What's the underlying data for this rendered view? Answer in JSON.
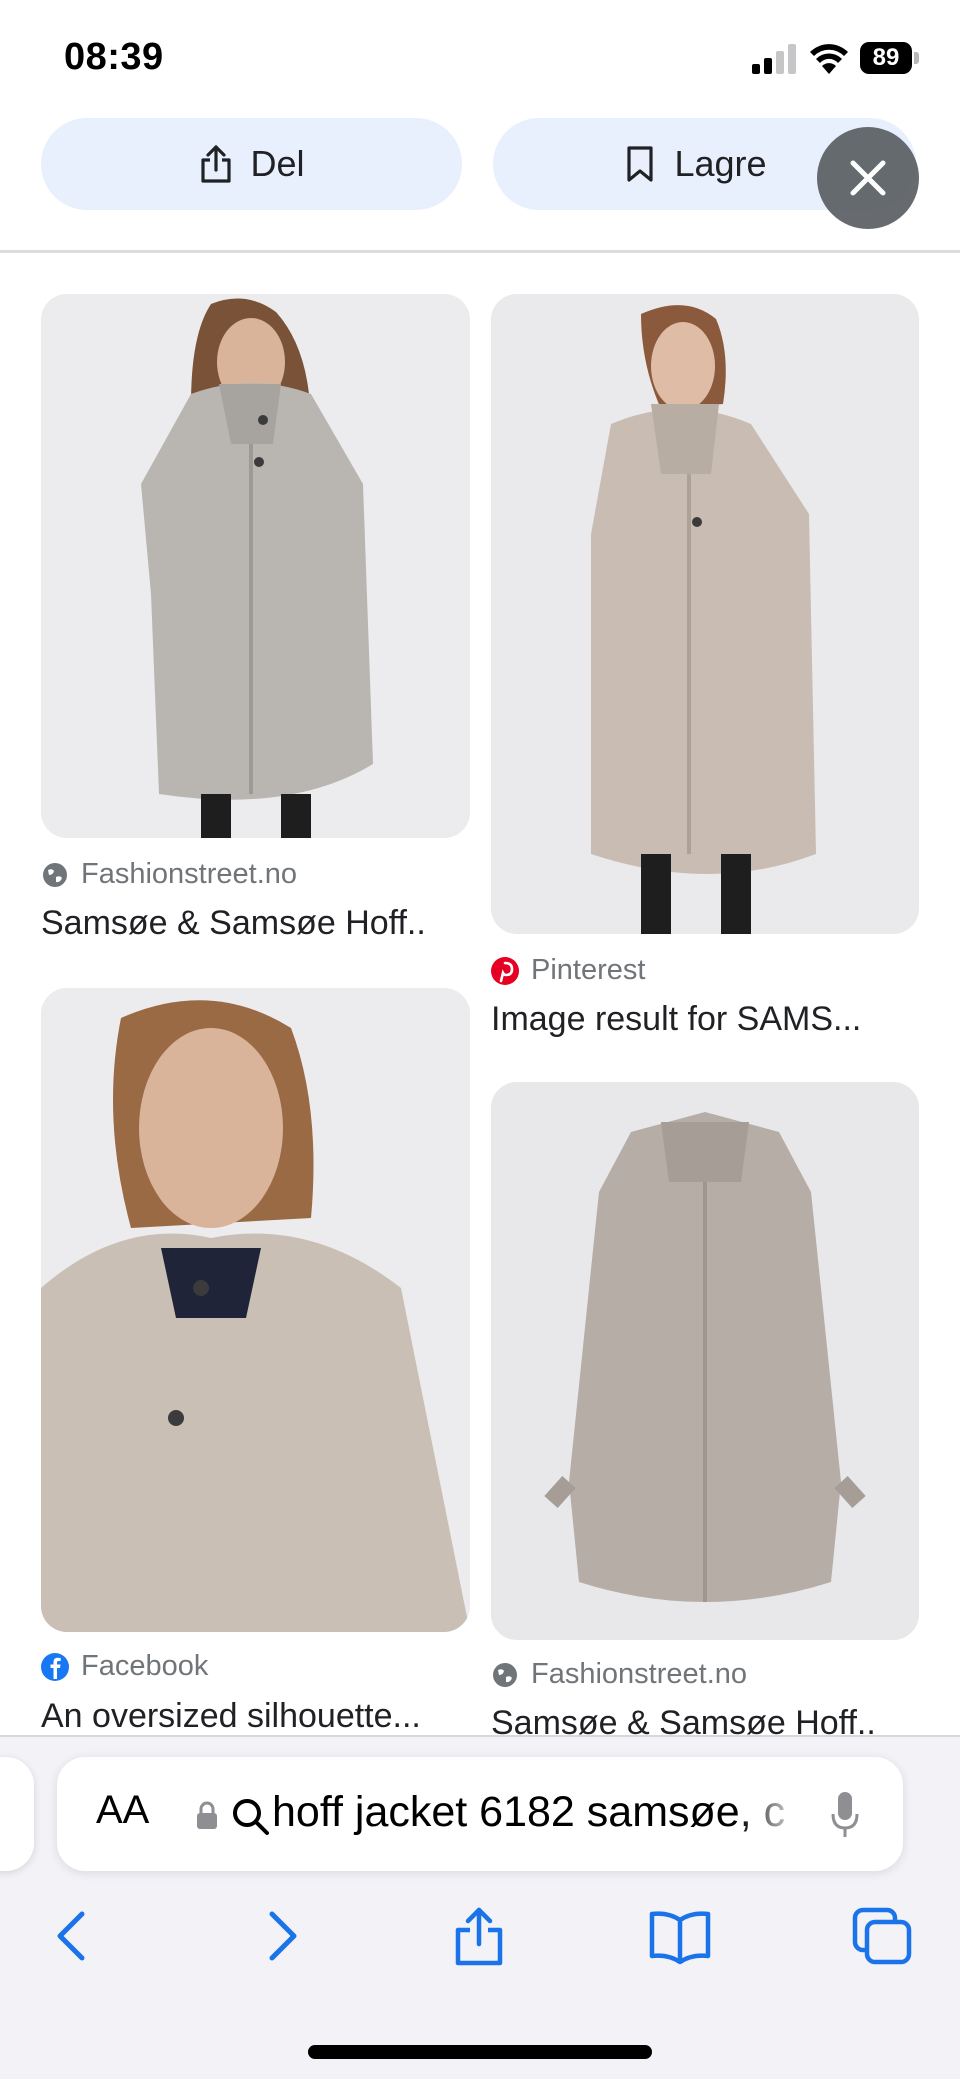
{
  "status_bar": {
    "time": "08:39",
    "battery": "89"
  },
  "actions": {
    "share_label": "Del",
    "save_label": "Lagre"
  },
  "results": [
    {
      "source": "Fashionstreet.no",
      "caption": "Samsøe & Samsøe Hoff..",
      "source_icon": "globe-icon"
    },
    {
      "source": "Pinterest",
      "caption": "Image result for SAMS...",
      "source_icon": "pinterest-icon"
    },
    {
      "source": "Facebook",
      "caption": "An oversized silhouette...",
      "source_icon": "facebook-icon"
    },
    {
      "source": "Fashionstreet.no",
      "caption": "Samsøe & Samsøe Hoff..",
      "source_icon": "globe-icon"
    }
  ],
  "address_bar": {
    "aa_label": "AA",
    "query": "hoff jacket 6182 samsøe, c"
  },
  "colors": {
    "pill_bg": "#e8f0fe",
    "close_bg": "#5f6368",
    "toolbar_blue": "#1a73e8",
    "pinterest": "#e60023",
    "facebook": "#1877f2"
  }
}
